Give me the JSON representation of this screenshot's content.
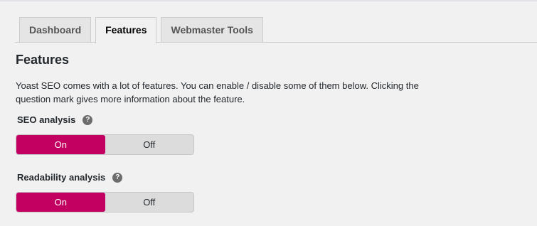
{
  "tabs": [
    {
      "label": "Dashboard",
      "active": false
    },
    {
      "label": "Features",
      "active": true
    },
    {
      "label": "Webmaster Tools",
      "active": false
    }
  ],
  "page": {
    "title": "Features",
    "intro": "Yoast SEO comes with a lot of features. You can enable / disable some of them below. Clicking the question mark gives more information about the feature."
  },
  "features": [
    {
      "label": "SEO analysis",
      "help": "?",
      "on_label": "On",
      "off_label": "Off",
      "value": "On"
    },
    {
      "label": "Readability analysis",
      "help": "?",
      "on_label": "On",
      "off_label": "Off",
      "value": "On"
    }
  ],
  "colors": {
    "accent": "#c30061"
  }
}
